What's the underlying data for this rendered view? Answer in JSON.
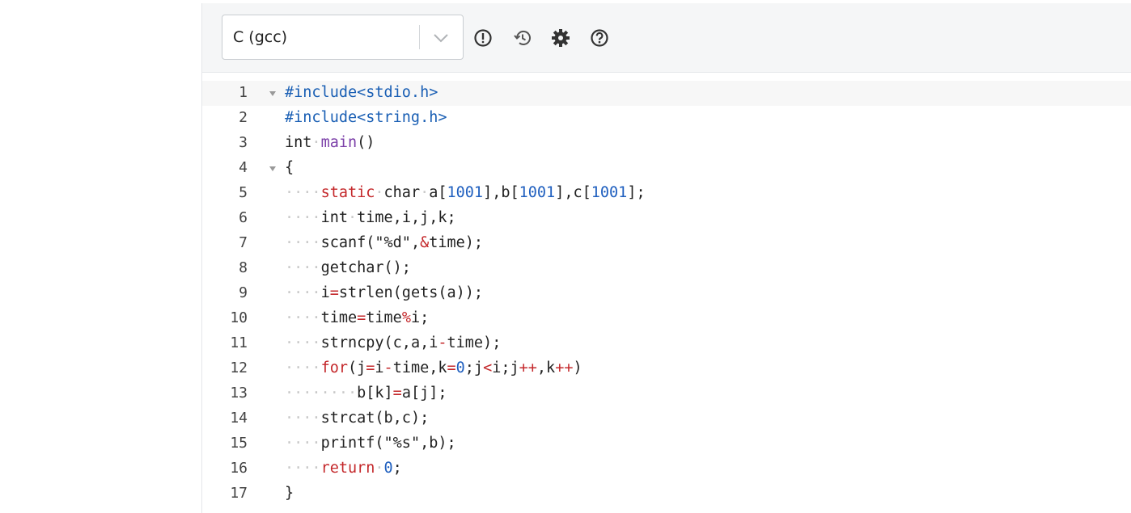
{
  "toolbar": {
    "language": "C (gcc)",
    "icons": [
      "alert-circle-icon",
      "history-icon",
      "gear-icon",
      "help-circle-icon"
    ]
  },
  "editor": {
    "active_line": 1,
    "lines": [
      {
        "n": "1",
        "fold": true
      },
      {
        "n": "2",
        "fold": false
      },
      {
        "n": "3",
        "fold": false
      },
      {
        "n": "4",
        "fold": true
      },
      {
        "n": "5",
        "fold": false
      },
      {
        "n": "6",
        "fold": false
      },
      {
        "n": "7",
        "fold": false
      },
      {
        "n": "8",
        "fold": false
      },
      {
        "n": "9",
        "fold": false
      },
      {
        "n": "10",
        "fold": false
      },
      {
        "n": "11",
        "fold": false
      },
      {
        "n": "12",
        "fold": false
      },
      {
        "n": "13",
        "fold": false
      },
      {
        "n": "14",
        "fold": false
      },
      {
        "n": "15",
        "fold": false
      },
      {
        "n": "16",
        "fold": false
      },
      {
        "n": "17",
        "fold": false
      }
    ],
    "tokens": [
      [
        [
          "pre",
          "#include<stdio.h>"
        ]
      ],
      [
        [
          "pre",
          "#include<string.h>"
        ]
      ],
      [
        [
          "",
          "int"
        ],
        [
          "ws",
          "·"
        ],
        [
          "fn",
          "main"
        ],
        [
          "",
          "()"
        ]
      ],
      [
        [
          "",
          "{"
        ]
      ],
      [
        [
          "ws",
          "····"
        ],
        [
          "kw",
          "static"
        ],
        [
          "ws",
          "·"
        ],
        [
          "",
          "char"
        ],
        [
          "ws",
          "·"
        ],
        [
          "",
          "a["
        ],
        [
          "num",
          "1001"
        ],
        [
          "",
          "],b["
        ],
        [
          "num",
          "1001"
        ],
        [
          "",
          "],c["
        ],
        [
          "num",
          "1001"
        ],
        [
          "",
          "];"
        ]
      ],
      [
        [
          "ws",
          "····"
        ],
        [
          "",
          "int"
        ],
        [
          "ws",
          "·"
        ],
        [
          "",
          "time,i,j,k;"
        ]
      ],
      [
        [
          "ws",
          "····"
        ],
        [
          "",
          "scanf("
        ],
        [
          "str",
          "\"%d\""
        ],
        [
          "",
          ","
        ],
        [
          "op",
          "&"
        ],
        [
          "",
          "time);"
        ]
      ],
      [
        [
          "ws",
          "····"
        ],
        [
          "",
          "getchar();"
        ]
      ],
      [
        [
          "ws",
          "····"
        ],
        [
          "",
          "i"
        ],
        [
          "op",
          "="
        ],
        [
          "",
          "strlen(gets(a));"
        ]
      ],
      [
        [
          "ws",
          "····"
        ],
        [
          "",
          "time"
        ],
        [
          "op",
          "="
        ],
        [
          "",
          "time"
        ],
        [
          "op",
          "%"
        ],
        [
          "",
          "i;"
        ]
      ],
      [
        [
          "ws",
          "····"
        ],
        [
          "",
          "strncpy(c,a,i"
        ],
        [
          "op",
          "-"
        ],
        [
          "",
          "time);"
        ]
      ],
      [
        [
          "ws",
          "····"
        ],
        [
          "kw",
          "for"
        ],
        [
          "",
          "(j"
        ],
        [
          "op",
          "="
        ],
        [
          "",
          "i"
        ],
        [
          "op",
          "-"
        ],
        [
          "",
          "time,k"
        ],
        [
          "op",
          "="
        ],
        [
          "num",
          "0"
        ],
        [
          "",
          ";j"
        ],
        [
          "op",
          "<"
        ],
        [
          "",
          "i;j"
        ],
        [
          "op",
          "++"
        ],
        [
          "",
          ",k"
        ],
        [
          "op",
          "++"
        ],
        [
          "",
          ")"
        ]
      ],
      [
        [
          "ws",
          "········"
        ],
        [
          "",
          "b[k]"
        ],
        [
          "op",
          "="
        ],
        [
          "",
          "a[j];"
        ]
      ],
      [
        [
          "ws",
          "····"
        ],
        [
          "",
          "strcat(b,c);"
        ]
      ],
      [
        [
          "ws",
          "····"
        ],
        [
          "",
          "printf("
        ],
        [
          "str",
          "\"%s\""
        ],
        [
          "",
          ",b);"
        ]
      ],
      [
        [
          "ws",
          "····"
        ],
        [
          "kw",
          "return"
        ],
        [
          "ws",
          "·"
        ],
        [
          "num",
          "0"
        ],
        [
          "",
          ";"
        ]
      ],
      [
        [
          "",
          "}"
        ]
      ]
    ]
  },
  "colors": {
    "preprocessor": "#1a5fb4",
    "keyword": "#c4282b",
    "function": "#7b3fa8",
    "number": "#1f5fbf",
    "whitespace_marker": "#c9c9c9"
  }
}
